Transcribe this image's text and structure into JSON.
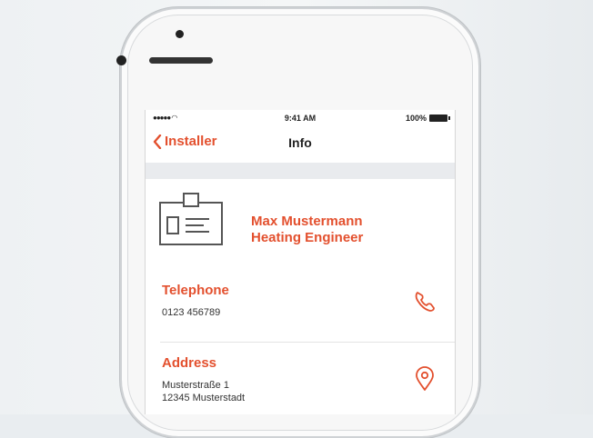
{
  "statusbar": {
    "signal": "●●●●● ",
    "time": "9:41 AM",
    "battery": "100%"
  },
  "navbar": {
    "back_label": "Installer",
    "title": "Info"
  },
  "profile": {
    "name": "Max Mustermann",
    "role": "Heating Engineer",
    "icon": "id-badge-icon"
  },
  "telephone": {
    "title": "Telephone",
    "value": "0123 456789",
    "icon": "phone-icon"
  },
  "address": {
    "title": "Address",
    "street": "Musterstraße 1",
    "city": "12345 Musterstadt",
    "icon": "location-pin-icon"
  },
  "colors": {
    "accent": "#e3502e",
    "band": "#e9ebee"
  }
}
